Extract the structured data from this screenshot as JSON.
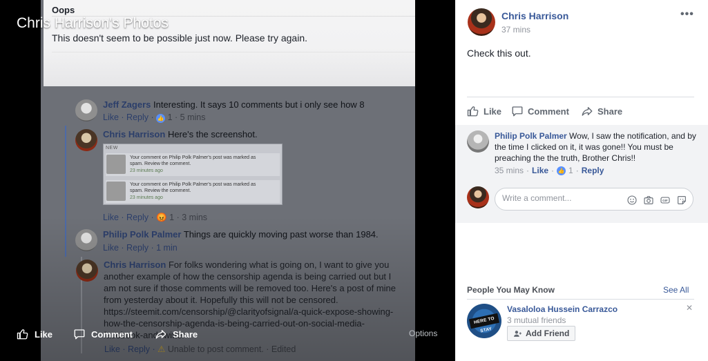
{
  "viewer": {
    "title": "Chris Harrison's Photos",
    "like_label": "Like",
    "comment_label": "Comment",
    "share_label": "Share",
    "options_label": "Options"
  },
  "dialog": {
    "title": "Oops",
    "message": "This doesn't seem to be possible just now. Please try again."
  },
  "photo": {
    "comment1": {
      "name": "Jeff Zagers",
      "text": "Interesting. It says 10 comments but i only see how 8",
      "actions": "Like · Reply · ",
      "reactions": "1 · 5 mins"
    },
    "comment2": {
      "name": "Chris Harrison",
      "text": "Here's the screenshot.",
      "actions": "Like · Reply · ",
      "reactions": "1 · 3 mins"
    },
    "screenshot": {
      "header": "NEW",
      "rows": [
        {
          "line1": "Your comment on Philip Polk Palmer's post was marked as",
          "line2": "spam. Review the comment.",
          "time": "23 minutes ago"
        },
        {
          "line1": "Your comment on Philip Polk Palmer's post was marked as",
          "line2": "spam. Review the comment.",
          "time": "23 minutes ago"
        }
      ]
    },
    "comment3": {
      "name": "Philip Polk Palmer",
      "text": "Things are quickly moving past worse than 1984.",
      "actions": "Like · Reply · 1 min"
    },
    "comment4": {
      "name": "Chris Harrison",
      "text": "For folks wondering what is going on, I want to give you another example of how the censorship agenda is being carried out but I am not sure if those comments will be removed too. Here's a post of mine from yesterday about it. Hopefully this will not be censored. https://steemit.com/censorship/@clarityofsignal/a-quick-expose-showing-how-the-censorship-agenda-is-being-carried-out-on-social-media-facebook-and-twitter",
      "actions": "Like · Reply · ",
      "error": "Unable to post comment. · Edited"
    }
  },
  "post": {
    "author": "Chris Harrison",
    "time": "37 mins",
    "text": "Check this out.",
    "more_label": "•••",
    "like_label": "Like",
    "comment_label": "Comment",
    "share_label": "Share"
  },
  "comment": {
    "name": "Philip Polk Palmer",
    "text": "Wow, I saw the notification, and by the time I clicked on it, it was gone!! You must be preaching the the truth, Brother Chris!!",
    "time": "35 mins",
    "like_label": "Like",
    "like_count": "1",
    "reply_label": "Reply"
  },
  "write_comment": {
    "placeholder": "Write a comment..."
  },
  "pymk": {
    "title": "People You May Know",
    "see_all": "See All",
    "name": "Vasaloloa Hussein Carrazco",
    "mutual": "3 mutual friends",
    "add_friend": "Add Friend",
    "badge": "HERE TO STAY"
  },
  "colors": {
    "link": "#385898",
    "like_blue": "#5890ff",
    "panel_bg": "#ffffff",
    "comment_bg": "#f2f3f5"
  },
  "icons": [
    "thumbs-up-icon",
    "comment-icon",
    "share-icon",
    "more-icon",
    "emoji-icon",
    "camera-icon",
    "gif-icon",
    "sticker-icon",
    "add-friend-icon",
    "close-icon"
  ]
}
